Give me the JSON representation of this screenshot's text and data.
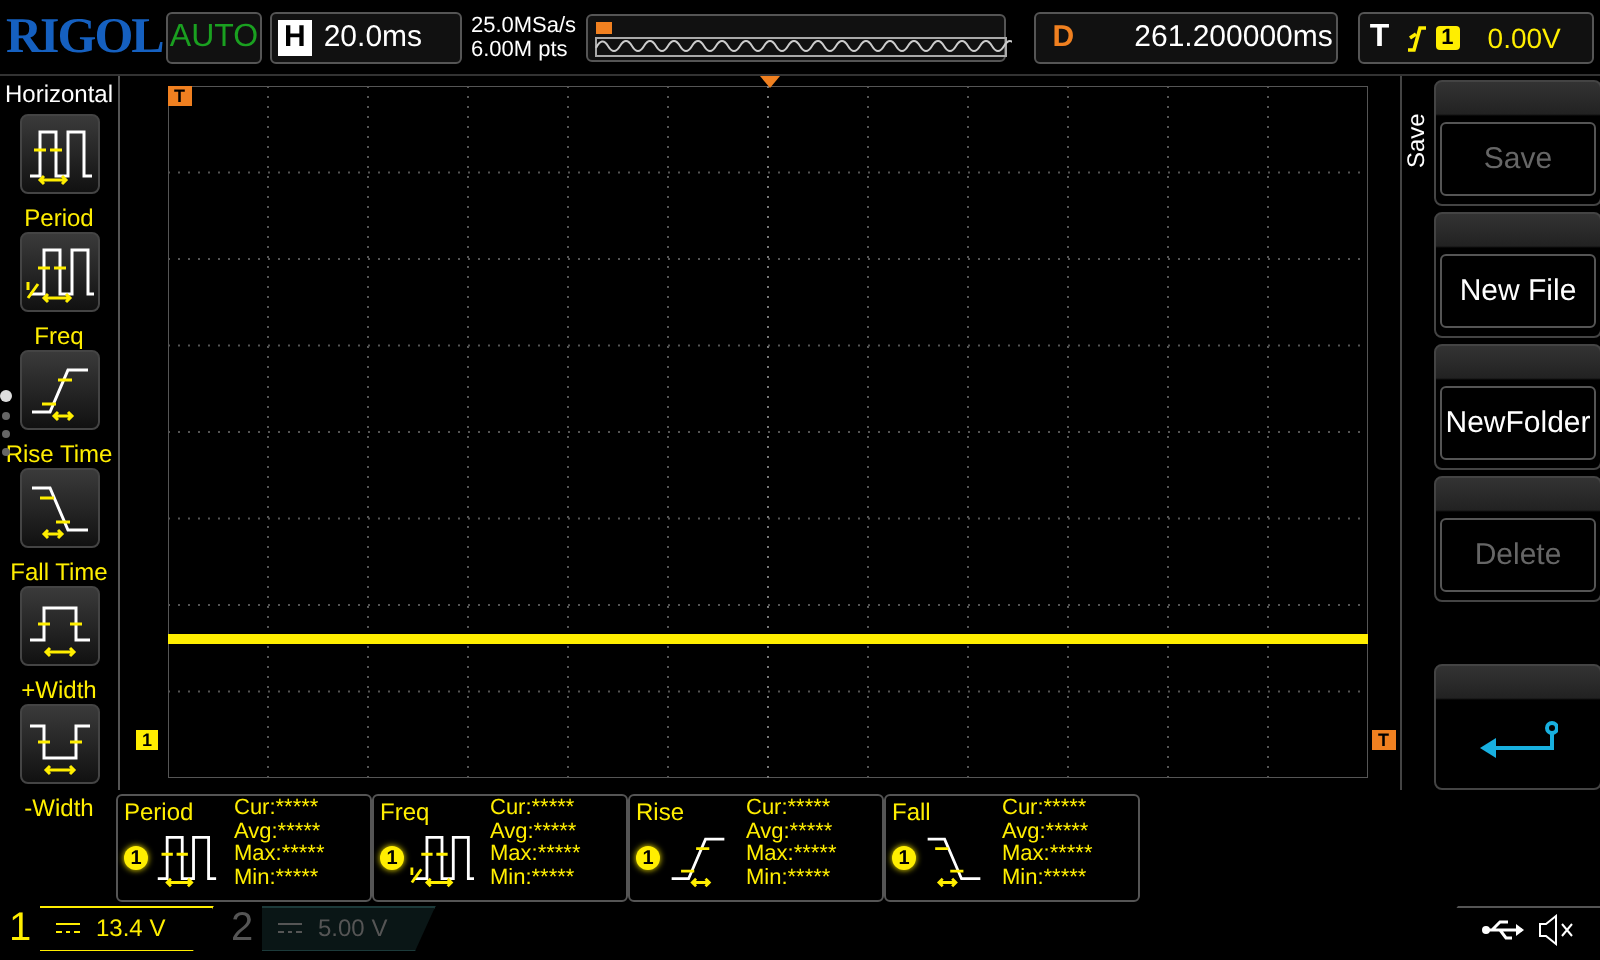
{
  "top_bar": {
    "logo": "RIGOL",
    "run_status": "AUTO",
    "horizontal": {
      "label": "H",
      "timebase": "20.0ms"
    },
    "sample_rate": "25.0MSa/s",
    "memory_depth": "6.00M pts",
    "delay": {
      "label": "D",
      "value": "261.200000ms"
    },
    "trigger": {
      "label": "T",
      "channel": "1",
      "level": "0.00V"
    }
  },
  "measure_menu": {
    "title": "Horizontal",
    "items": [
      {
        "label": "Period",
        "kind": "period"
      },
      {
        "label": "Freq",
        "kind": "freq"
      },
      {
        "label": "Rise Time",
        "kind": "rise"
      },
      {
        "label": "Fall Time",
        "kind": "fall"
      },
      {
        "label": "+Width",
        "kind": "pwidth"
      },
      {
        "label": "-Width",
        "kind": "nwidth"
      }
    ],
    "pages": [
      {
        "selected": true
      },
      {
        "selected": false
      },
      {
        "selected": false
      },
      {
        "selected": false
      }
    ]
  },
  "waveform": {
    "trigger_position_marker": "T",
    "channel_marker": "1",
    "trigger_level_marker": "T"
  },
  "softkeys": {
    "title": "Save",
    "buttons": [
      {
        "kind": "text",
        "label": "Save",
        "disabled": true
      },
      {
        "kind": "text",
        "label": "New File",
        "disabled": false
      },
      {
        "kind": "text",
        "label": "NewFolder",
        "disabled": false
      },
      {
        "kind": "text",
        "label": "Delete",
        "disabled": true
      },
      {
        "kind": "back"
      }
    ]
  },
  "measurements": [
    {
      "name": "Period",
      "source": "1",
      "kind": "period",
      "rows": [
        {
          "label": "Cur:",
          "value": "*****"
        },
        {
          "label": "Avg:",
          "value": "*****"
        },
        {
          "label": "Max:",
          "value": "*****"
        },
        {
          "label": "Min:",
          "value": "*****"
        }
      ]
    },
    {
      "name": "Freq",
      "source": "1",
      "kind": "freq",
      "rows": [
        {
          "label": "Cur:",
          "value": "*****"
        },
        {
          "label": "Avg:",
          "value": "*****"
        },
        {
          "label": "Max:",
          "value": "*****"
        },
        {
          "label": "Min:",
          "value": "*****"
        }
      ]
    },
    {
      "name": "Rise",
      "source": "1",
      "kind": "rise",
      "rows": [
        {
          "label": "Cur:",
          "value": "*****"
        },
        {
          "label": "Avg:",
          "value": "*****"
        },
        {
          "label": "Max:",
          "value": "*****"
        },
        {
          "label": "Min:",
          "value": "*****"
        }
      ]
    },
    {
      "name": "Fall",
      "source": "1",
      "kind": "fall",
      "rows": [
        {
          "label": "Cur:",
          "value": "*****"
        },
        {
          "label": "Avg:",
          "value": "*****"
        },
        {
          "label": "Max:",
          "value": "*****"
        },
        {
          "label": "Min:",
          "value": "*****"
        }
      ]
    }
  ],
  "channels": [
    {
      "number": "1",
      "scale": "13.4 V",
      "on": true
    },
    {
      "number": "2",
      "scale": "5.00 V",
      "on": false
    }
  ]
}
